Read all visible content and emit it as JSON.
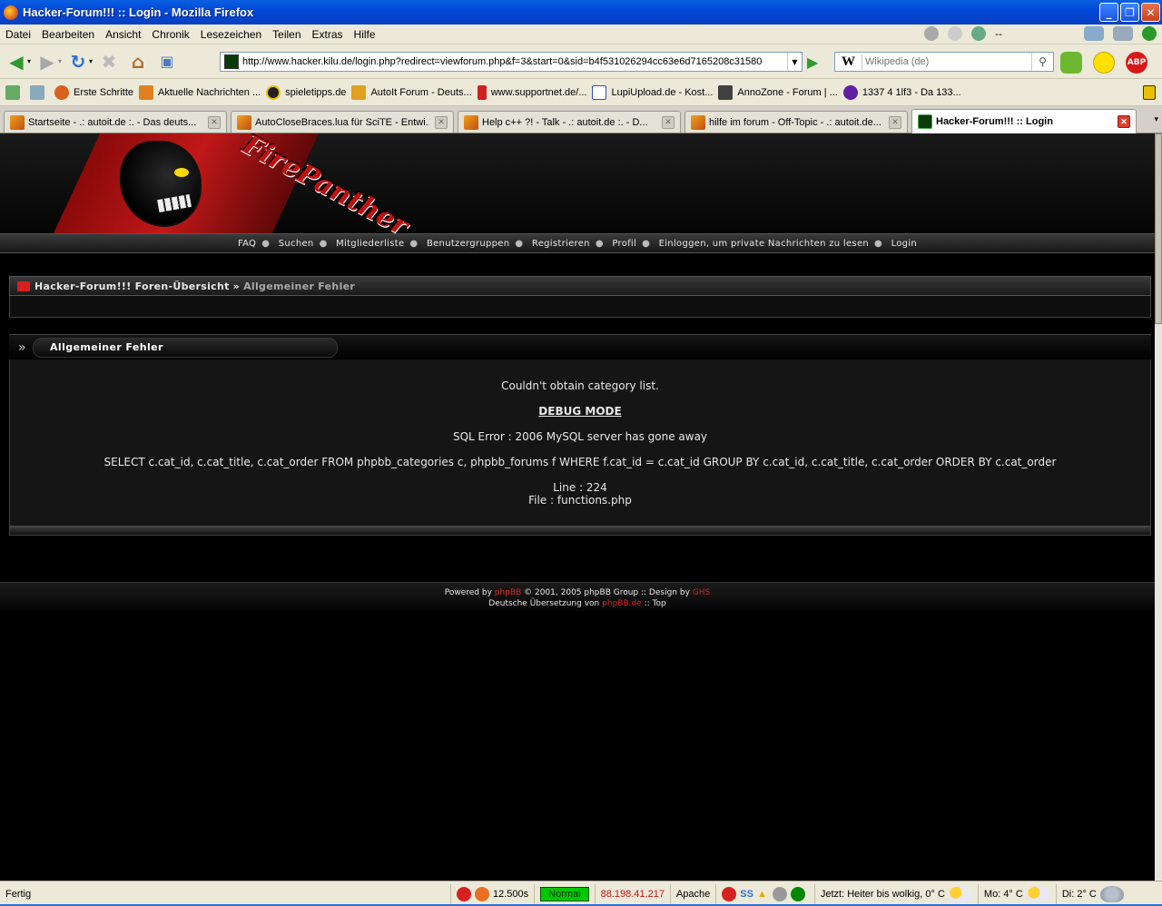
{
  "window": {
    "title": "Hacker-Forum!!! :: Login - Mozilla Firefox"
  },
  "menu": [
    "Datei",
    "Bearbeiten",
    "Ansicht",
    "Chronik",
    "Lesezeichen",
    "Teilen",
    "Extras",
    "Hilfe"
  ],
  "menu_right": {
    "dash": "--"
  },
  "nav": {
    "url": "http://www.hacker.kilu.de/login.php?redirect=viewforum.php&f=3&start=0&sid=b4f531026294cc63e6d7165208c31580",
    "search_placeholder": "Wikipedia (de)",
    "search_engine_glyph": "W",
    "abp_label": "ABP"
  },
  "bookmarks": [
    {
      "label": "Erste Schritte",
      "icon": "gear-icon",
      "color": "#d86020"
    },
    {
      "label": "Aktuelle Nachrichten ...",
      "icon": "rss-icon",
      "color": "#e08020"
    },
    {
      "label": "spieletipps.de",
      "icon": "spieletipps-icon",
      "color": "#202020"
    },
    {
      "label": "AutoIt Forum - Deuts...",
      "icon": "autoit-icon",
      "color": "#e0a020"
    },
    {
      "label": "www.supportnet.de/...",
      "icon": "supportnet-icon",
      "color": "#d02020"
    },
    {
      "label": "LupiUpload.de - Kost...",
      "icon": "page-icon",
      "color": "#3050c0"
    },
    {
      "label": "AnnoZone - Forum | ...",
      "icon": "annozone-icon",
      "color": "#404040"
    },
    {
      "label": "1337 4 1lf3 - Da 133...",
      "icon": "s-icon",
      "color": "#6020a0"
    }
  ],
  "tabs": [
    {
      "label": "Startseite - .: autoit.de :. - Das deuts...",
      "active": false
    },
    {
      "label": "AutoCloseBraces.lua für SciTE - Entwi...",
      "active": false
    },
    {
      "label": "Help c++ ?! - Talk - .: autoit.de :. - D...",
      "active": false
    },
    {
      "label": "hilfe im forum - Off-Topic - .: autoit.de...",
      "active": false
    },
    {
      "label": "Hacker-Forum!!! :: Login",
      "active": true
    }
  ],
  "site": {
    "logo_text": "FirePanther",
    "nav_links": [
      "FAQ",
      "Suchen",
      "Mitgliederliste",
      "Benutzergruppen",
      "Registrieren",
      "Profil",
      "Einloggen, um private Nachrichten zu lesen",
      "Login"
    ],
    "breadcrumb": {
      "home": "Hacker-Forum!!! Foren-Übersicht",
      "sep": "»",
      "current": "Allgemeiner Fehler"
    },
    "error": {
      "title": "Allgemeiner Fehler",
      "message": "Couldn't obtain category list.",
      "debug": "DEBUG MODE",
      "sql_error": "SQL Error : 2006 MySQL server has gone away",
      "query": "SELECT c.cat_id, c.cat_title, c.cat_order FROM phpbb_categories c, phpbb_forums f WHERE f.cat_id = c.cat_id GROUP BY c.cat_id, c.cat_title, c.cat_order ORDER BY c.cat_order",
      "line": "Line : 224",
      "file": "File : functions.php"
    },
    "footer": {
      "powered": "Powered by",
      "phpbb": "phpBB",
      "copy": "© 2001, 2005 phpBB Group :: Design by",
      "ghs": "GHS",
      "translation": "Deutsche Übersetzung von",
      "phpbbde": "phpBB.de",
      "top": ":: Top"
    }
  },
  "status": {
    "text": "Fertig",
    "load_time": "12.500s",
    "mode": "Normal",
    "ip": "88.198.41.217",
    "server": "Apache",
    "ss": "SS",
    "weather_now": "Jetzt: Heiter bis wolkig, 0° C",
    "weather_mo": "Mo: 4° C",
    "weather_di": "Di: 2° C"
  },
  "colors": {
    "accent_red": "#d82020",
    "status_green": "#00c800",
    "ip_red": "#c81818"
  }
}
